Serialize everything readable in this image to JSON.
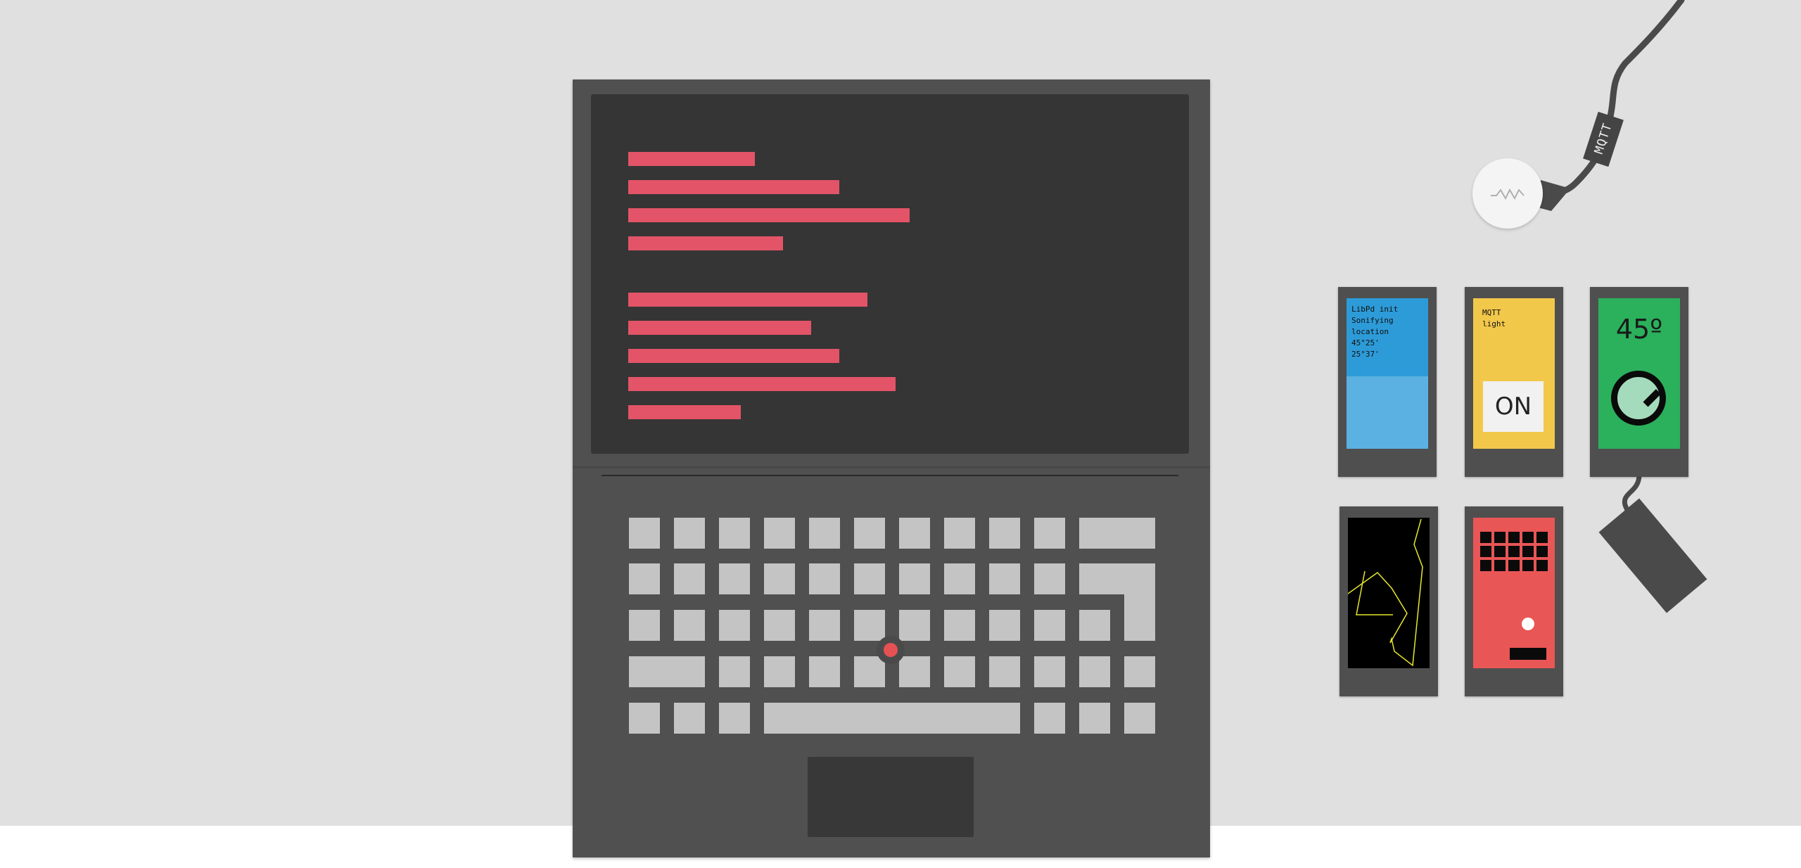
{
  "phones": {
    "info": {
      "lines": "LibPd init\nSonifying\nlocation\n45°25'\n25°37'",
      "color_top": "#2d9bd8",
      "color_bottom": "#5bb1e2"
    },
    "light": {
      "lines": "MQTT\nlight",
      "button_label": "ON",
      "color": "#f2c84b"
    },
    "dial": {
      "angle_label": "45º",
      "color": "#2bb05c"
    },
    "graph": {
      "color": "#000000",
      "line_color": "#e6e62e"
    },
    "pad": {
      "color": "#e95656",
      "grid_rows": 3,
      "grid_cols": 5
    }
  },
  "cable_tag": {
    "label": "MQTT"
  },
  "icons": {
    "sensor": "wave-icon",
    "battery": "battery-pack-icon"
  },
  "colors": {
    "background": "#e0e0e0",
    "laptop": "#505050",
    "screen": "#353535",
    "code": "#e35468",
    "keys": "#c4c4c4",
    "trackpoint": "#e65154"
  }
}
